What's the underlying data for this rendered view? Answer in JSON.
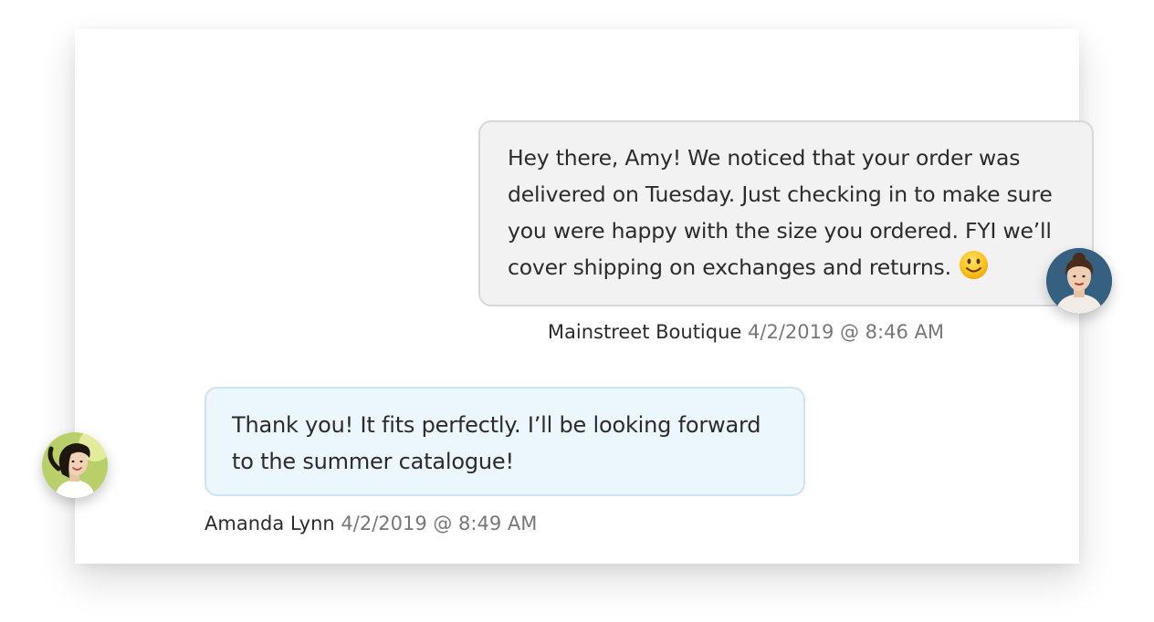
{
  "conversation": {
    "messages": [
      {
        "direction": "outgoing",
        "text": "Hey there, Amy! We noticed that your order was delivered on Tuesday. Just checking in to make sure you were happy with the size you ordered. FYI we’ll cover shipping on exchanges and returns.",
        "emoji_icon": "slightly-smiling-face-icon",
        "sender": "Mainstreet Boutique",
        "timestamp": "4/2/2019 @ 8:46 AM",
        "bubble_color": "#f2f2f2",
        "avatar_icon": "woman-avatar-icon"
      },
      {
        "direction": "incoming",
        "text": "Thank you! It fits perfectly. I’ll be looking forward to the summer catalogue!",
        "sender": "Amanda Lynn",
        "timestamp": "4/2/2019 @ 8:49 AM",
        "bubble_color": "#ecf6fd",
        "avatar_icon": "woman-avatar-icon"
      }
    ]
  }
}
